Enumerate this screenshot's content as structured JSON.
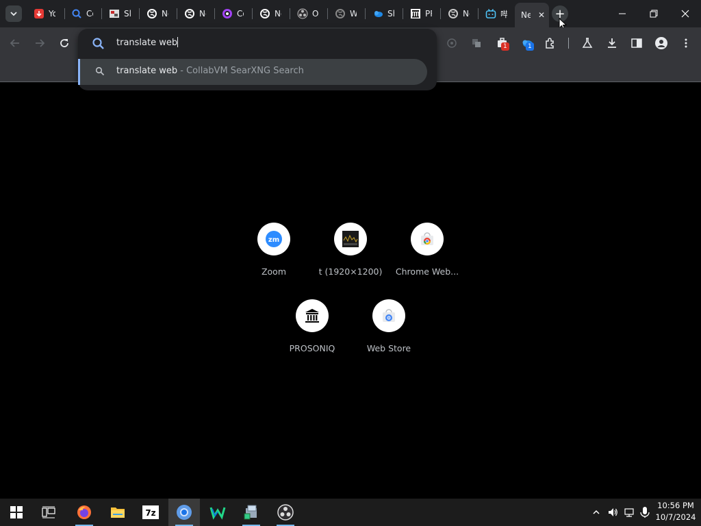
{
  "browser": {
    "tabs": [
      {
        "icon": "youtube-download-icon",
        "title": "Yo"
      },
      {
        "icon": "search-icon",
        "title": "Co"
      },
      {
        "icon": "image-icon",
        "title": "Sl"
      },
      {
        "icon": "globe-icon",
        "title": "Ne"
      },
      {
        "icon": "globe-icon",
        "title": "Ne"
      },
      {
        "icon": "podcast-icon",
        "title": "Co"
      },
      {
        "icon": "globe-icon",
        "title": "Ne"
      },
      {
        "icon": "obs-icon",
        "title": "OB"
      },
      {
        "icon": "globe-icon",
        "title": "Wi"
      },
      {
        "icon": "cloud-icon",
        "title": "Sh"
      },
      {
        "icon": "museum-icon",
        "title": "PR"
      },
      {
        "icon": "globe-icon",
        "title": "Ne"
      },
      {
        "icon": "bilibili-icon",
        "title": "哔"
      }
    ],
    "active_tab": {
      "title": "Ne",
      "close": "✕"
    },
    "new_tab_label": "+"
  },
  "toolbar": {
    "extension_badges": [
      "1",
      "1"
    ]
  },
  "omnibox": {
    "input_value": "translate web",
    "suggestion": {
      "query": "translate web",
      "separator": " - ",
      "engine": "CollabVM SearXNG Search"
    }
  },
  "shortcuts": [
    {
      "label": "Zoom",
      "icon": "zoom-icon"
    },
    {
      "label": "t (1920×1200)",
      "icon": "waveform-thumbnail-icon"
    },
    {
      "label": "Chrome Web...",
      "icon": "chrome-web-store-icon"
    },
    {
      "label": "PROSONIQ",
      "icon": "museum-icon"
    },
    {
      "label": "Web Store",
      "icon": "chrome-web-store-icon"
    }
  ],
  "taskbar": {
    "items": [
      "windows-start-icon",
      "task-view-icon",
      "firefox-icon",
      "file-explorer-icon",
      "7zip-icon",
      "chrome-icon",
      "webstorm-icon",
      "installer-icon",
      "obs-icon"
    ],
    "time": "10:56 PM",
    "date": "10/7/2024"
  },
  "colors": {
    "accent": "#8ab4f8",
    "tabstrip": "#202124",
    "toolbar": "#35363a",
    "taskbar_active_underline": "#76b9ed"
  }
}
